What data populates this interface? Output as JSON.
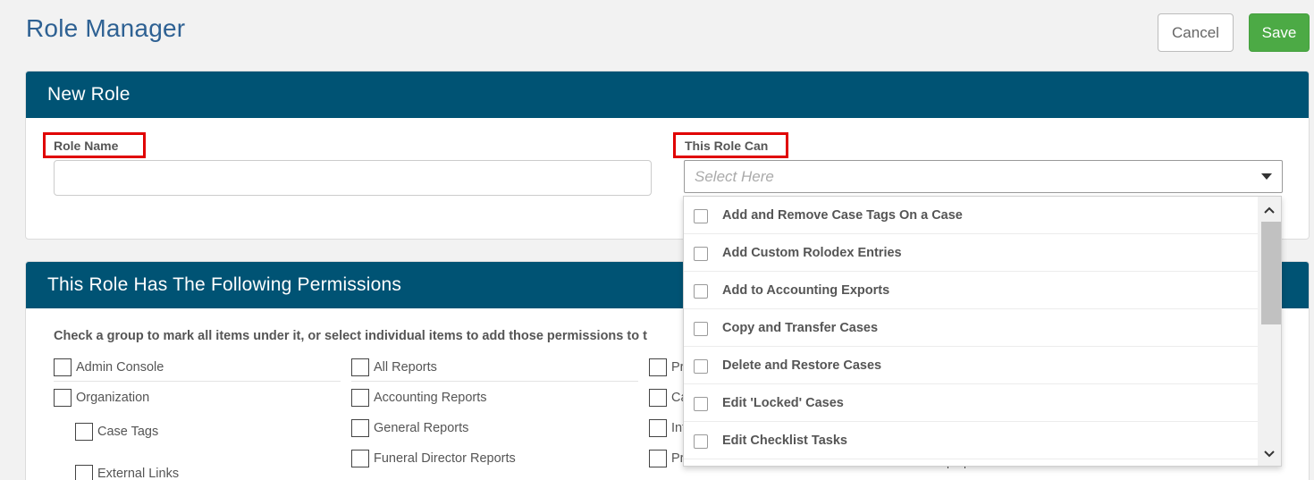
{
  "header": {
    "title": "Role Manager",
    "cancel_label": "Cancel",
    "save_label": "Save"
  },
  "new_role": {
    "title": "New Role",
    "role_name_label": "Role Name",
    "role_name_value": "",
    "role_can_label": "This Role Can",
    "select_placeholder": "Select Here"
  },
  "permissions": {
    "title": "This Role Has The Following Permissions",
    "instructions": "Check a group to mark all items under it, or select individual items to add those permissions to t",
    "col1": [
      "Admin Console",
      "Organization",
      "Case Tags",
      "External Links"
    ],
    "col2": [
      "All Reports",
      "Accounting Reports",
      "General Reports",
      "Funeral Director Reports"
    ],
    "col3": [
      "Pr",
      "Ca",
      "Int",
      "Pr"
    ]
  },
  "dropdown": {
    "items": [
      "Add and Remove Case Tags On a Case",
      "Add Custom Rolodex Entries",
      "Add to Accounting Exports",
      "Copy and Transfer Cases",
      "Delete and Restore Cases",
      "Edit 'Locked' Cases",
      "Edit Checklist Tasks"
    ]
  },
  "icons": {
    "caret": "caret-down-icon",
    "scroll_up": "chevron-up-icon",
    "scroll_down": "chevron-down-icon"
  },
  "colors": {
    "header_bg": "#005374",
    "save_bg": "#4caa45",
    "title": "#2e6193",
    "highlight": "#e00000"
  }
}
